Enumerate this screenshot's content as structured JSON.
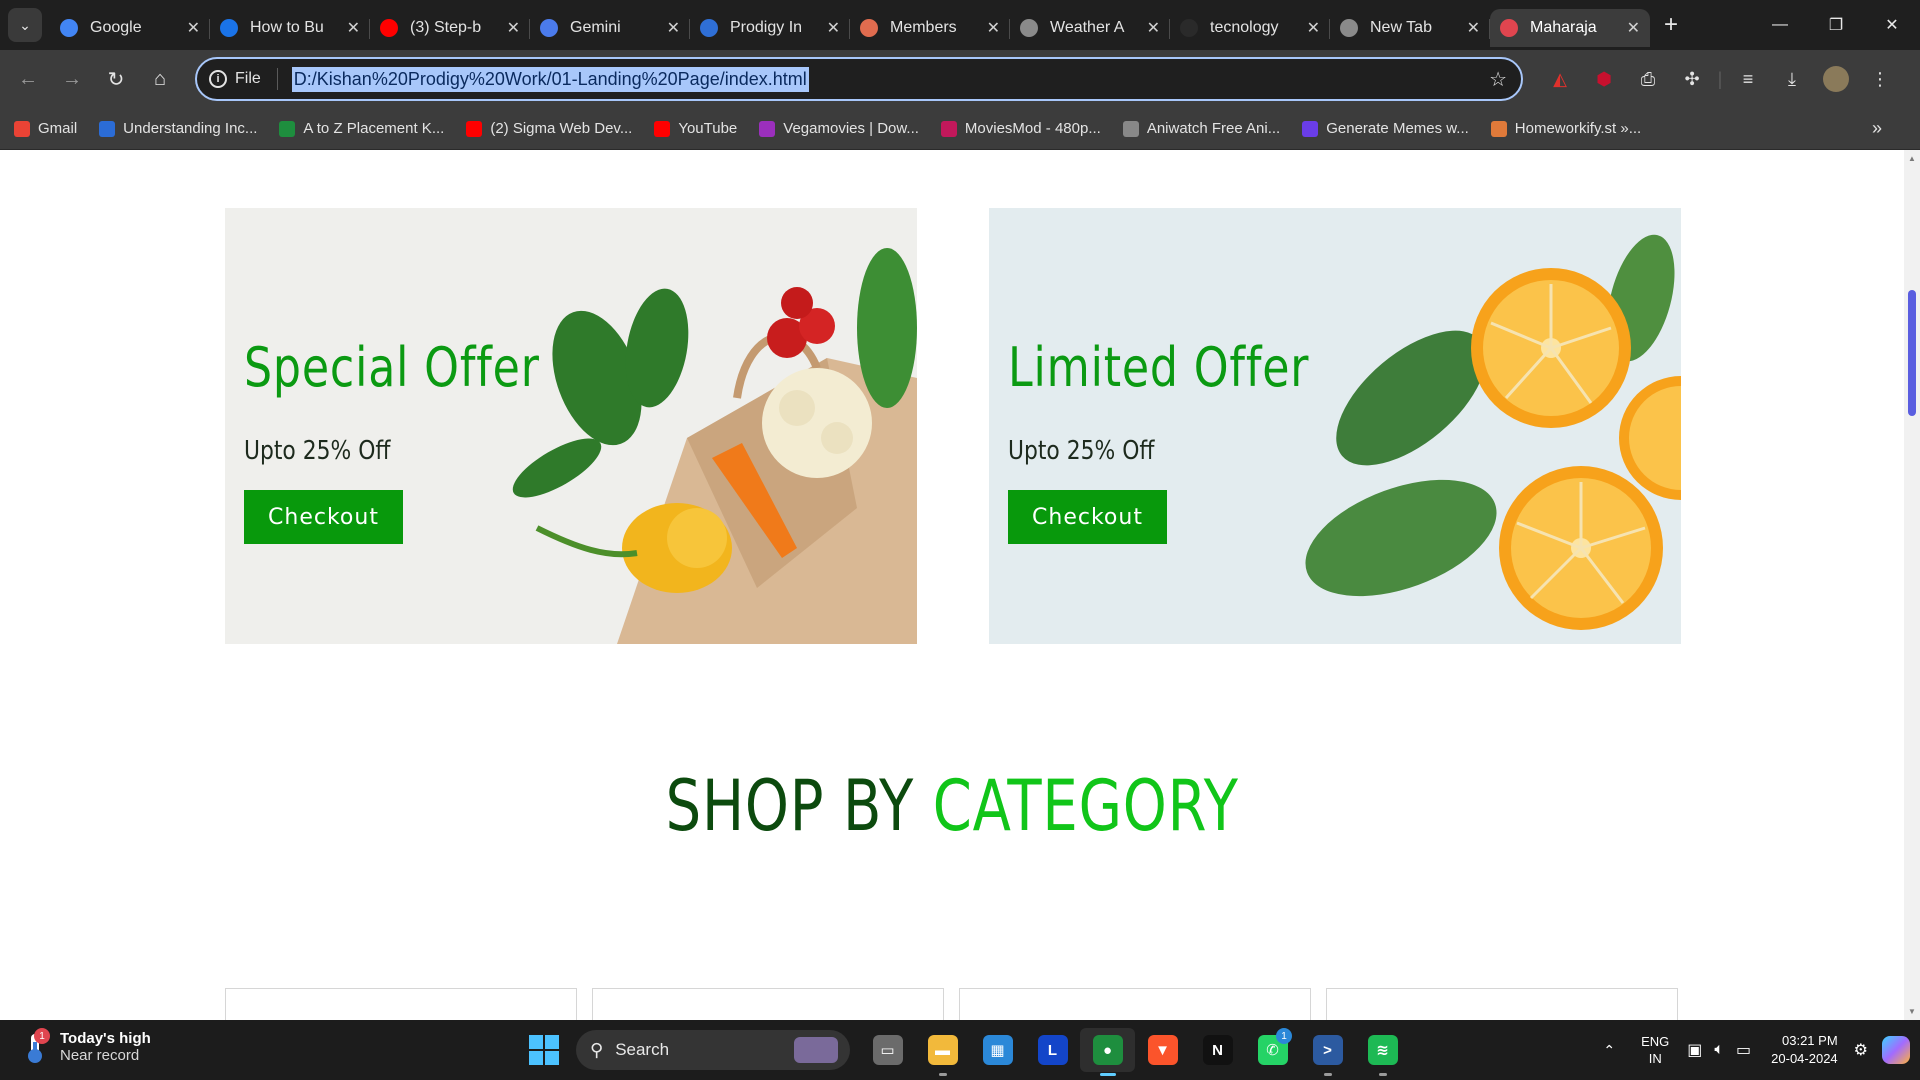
{
  "browser": {
    "tabs": [
      {
        "title": "Google",
        "icon": "google-icon",
        "color": "#4285f4"
      },
      {
        "title": "How to Bu",
        "icon": "codingninjas-icon",
        "color": "#1a73e8"
      },
      {
        "title": "(3) Step-b",
        "icon": "youtube-icon",
        "color": "#ff0000"
      },
      {
        "title": "Gemini",
        "icon": "gemini-icon",
        "color": "#4b7bec"
      },
      {
        "title": "Prodigy In",
        "icon": "prodigy-icon",
        "color": "#2f6fd6"
      },
      {
        "title": "Members",
        "icon": "members-icon",
        "color": "#e06c4f"
      },
      {
        "title": "Weather A",
        "icon": "globe-icon",
        "color": "#8a8a8a"
      },
      {
        "title": "tecnology",
        "icon": "github-icon",
        "color": "#2a2a2a"
      },
      {
        "title": "New Tab",
        "icon": "chrome-icon",
        "color": "#8a8a8a"
      },
      {
        "title": "Maharaja",
        "icon": "maharaja-icon",
        "color": "#e0454f"
      }
    ],
    "omnibox": {
      "scheme_label": "File",
      "url": "D:/Kishan%20Prodigy%20Work/01-Landing%20Page/index.html"
    },
    "bookmarks": [
      {
        "label": "Gmail",
        "icon": "gmail-icon",
        "color": "#ea4335"
      },
      {
        "label": "Understanding Inc...",
        "icon": "bookmark-s-icon",
        "color": "#2b6cd6"
      },
      {
        "label": "A to Z Placement K...",
        "icon": "sheets-icon",
        "color": "#1e8e3e"
      },
      {
        "label": "(2) Sigma Web Dev...",
        "icon": "youtube-icon",
        "color": "#ff0000"
      },
      {
        "label": "YouTube",
        "icon": "youtube-icon",
        "color": "#ff0000"
      },
      {
        "label": "Vegamovies | Dow...",
        "icon": "vegamovies-icon",
        "color": "#9b2fbd"
      },
      {
        "label": "MoviesMod - 480p...",
        "icon": "moviesmod-icon",
        "color": "#c2185b"
      },
      {
        "label": "Aniwatch Free Ani...",
        "icon": "aniwatch-icon",
        "color": "#888888"
      },
      {
        "label": "Generate Memes w...",
        "icon": "memes-s-icon",
        "color": "#6a3de8"
      },
      {
        "label": "Homeworkify.st »...",
        "icon": "homeworkify-icon",
        "color": "#e07a3a"
      }
    ]
  },
  "page": {
    "offers": [
      {
        "title": "Special Offer",
        "subtitle": "Upto 25% Off",
        "button": "Checkout"
      },
      {
        "title": "Limited Offer",
        "subtitle": "Upto 25% Off",
        "button": "Checkout"
      }
    ],
    "section_heading": {
      "part1": "SHOP BY",
      "part2": "CATEGORY"
    },
    "colors": {
      "primary_green": "#08990c",
      "heading_dark": "#0c4a0e",
      "heading_green": "#11c519"
    }
  },
  "taskbar": {
    "weather": {
      "line1": "Today's high",
      "line2": "Near record",
      "badge": "1"
    },
    "search_label": "Search",
    "apps": [
      {
        "name": "task-view-icon",
        "glyph": "▭",
        "color": "#6b6b6b"
      },
      {
        "name": "file-explorer-icon",
        "glyph": "▬",
        "color": "#f2b93b"
      },
      {
        "name": "microsoft-store-icon",
        "glyph": "▦",
        "color": "#2b88d8"
      },
      {
        "name": "l-app-icon",
        "glyph": "L",
        "color": "#1345c9"
      },
      {
        "name": "chrome-icon",
        "glyph": "●",
        "color": "#1e8e3e"
      },
      {
        "name": "brave-icon",
        "glyph": "▼",
        "color": "#fb542b"
      },
      {
        "name": "netflix-icon",
        "glyph": "N",
        "color": "#111111"
      },
      {
        "name": "whatsapp-icon",
        "glyph": "✆",
        "color": "#25d366"
      },
      {
        "name": "powershell-icon",
        "glyph": ">",
        "color": "#2c5aa0"
      },
      {
        "name": "spotify-icon",
        "glyph": "≋",
        "color": "#1db954"
      }
    ],
    "whatsapp_badge": "1",
    "tray": {
      "lang1": "ENG",
      "lang2": "IN",
      "time": "03:21 PM",
      "date": "20-04-2024"
    }
  }
}
